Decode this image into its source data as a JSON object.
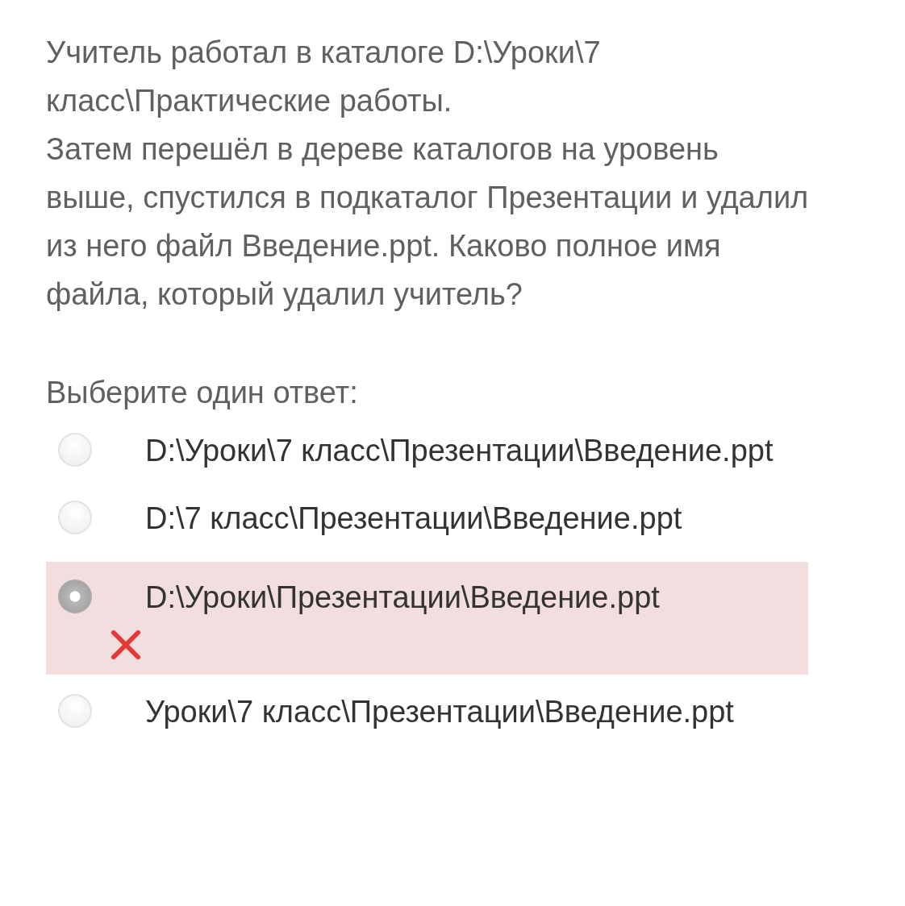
{
  "question": {
    "paragraphs": [
      "Учитель работал в каталоге D:\\Уроки\\7 класс\\Практические работы.",
      "Затем перешёл в дереве каталогов на уровень выше, спустился в подкаталог Презентации и удалил из него файл Введение.ppt. Каково полное имя файла, который удалил учитель?"
    ]
  },
  "prompt": "Выберите один ответ:",
  "options": [
    {
      "label": "D:\\Уроки\\7 класс\\Презентации\\Введение.ppt",
      "selected": false,
      "incorrect": false
    },
    {
      "label": "D:\\7 класс\\Презентации\\Введение.ppt",
      "selected": false,
      "incorrect": false
    },
    {
      "label": "D:\\Уроки\\Презентации\\Введение.ppt",
      "selected": true,
      "incorrect": true
    },
    {
      "label": "Уроки\\7 класс\\Презентации\\Введение.ppt",
      "selected": false,
      "incorrect": false
    }
  ]
}
